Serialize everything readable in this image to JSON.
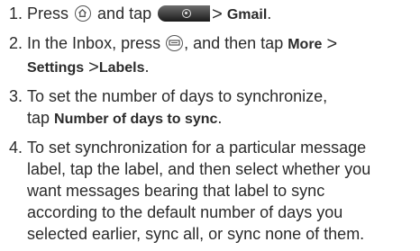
{
  "steps": [
    {
      "number": "1.",
      "press_text": "Press",
      "and_tap_text": "and tap",
      "separator": ">",
      "app_label": "Gmail"
    },
    {
      "number": "2.",
      "line1_pre": "In the Inbox, press",
      "line1_mid": ", and then tap",
      "more_label": "More",
      "separator": ">",
      "settings_label": "Settings",
      "labels_label": "Labels",
      "end_period": "."
    },
    {
      "number": "3.",
      "line1": "To set the number of days to synchronize,",
      "tap_text": "tap",
      "option_label": "Number of days to sync",
      "end_period": "."
    },
    {
      "number": "4.",
      "lines": [
        "To set synchronization for a particular message",
        "label, tap the label, and then select whether you",
        "want messages bearing that label to sync",
        "according to the default number of days you",
        "selected earlier, sync all, or sync none of them."
      ]
    }
  ],
  "icons": {
    "home": "home-key-icon",
    "apps_tab": "all-apps-tab-icon",
    "menu": "menu-key-icon"
  }
}
